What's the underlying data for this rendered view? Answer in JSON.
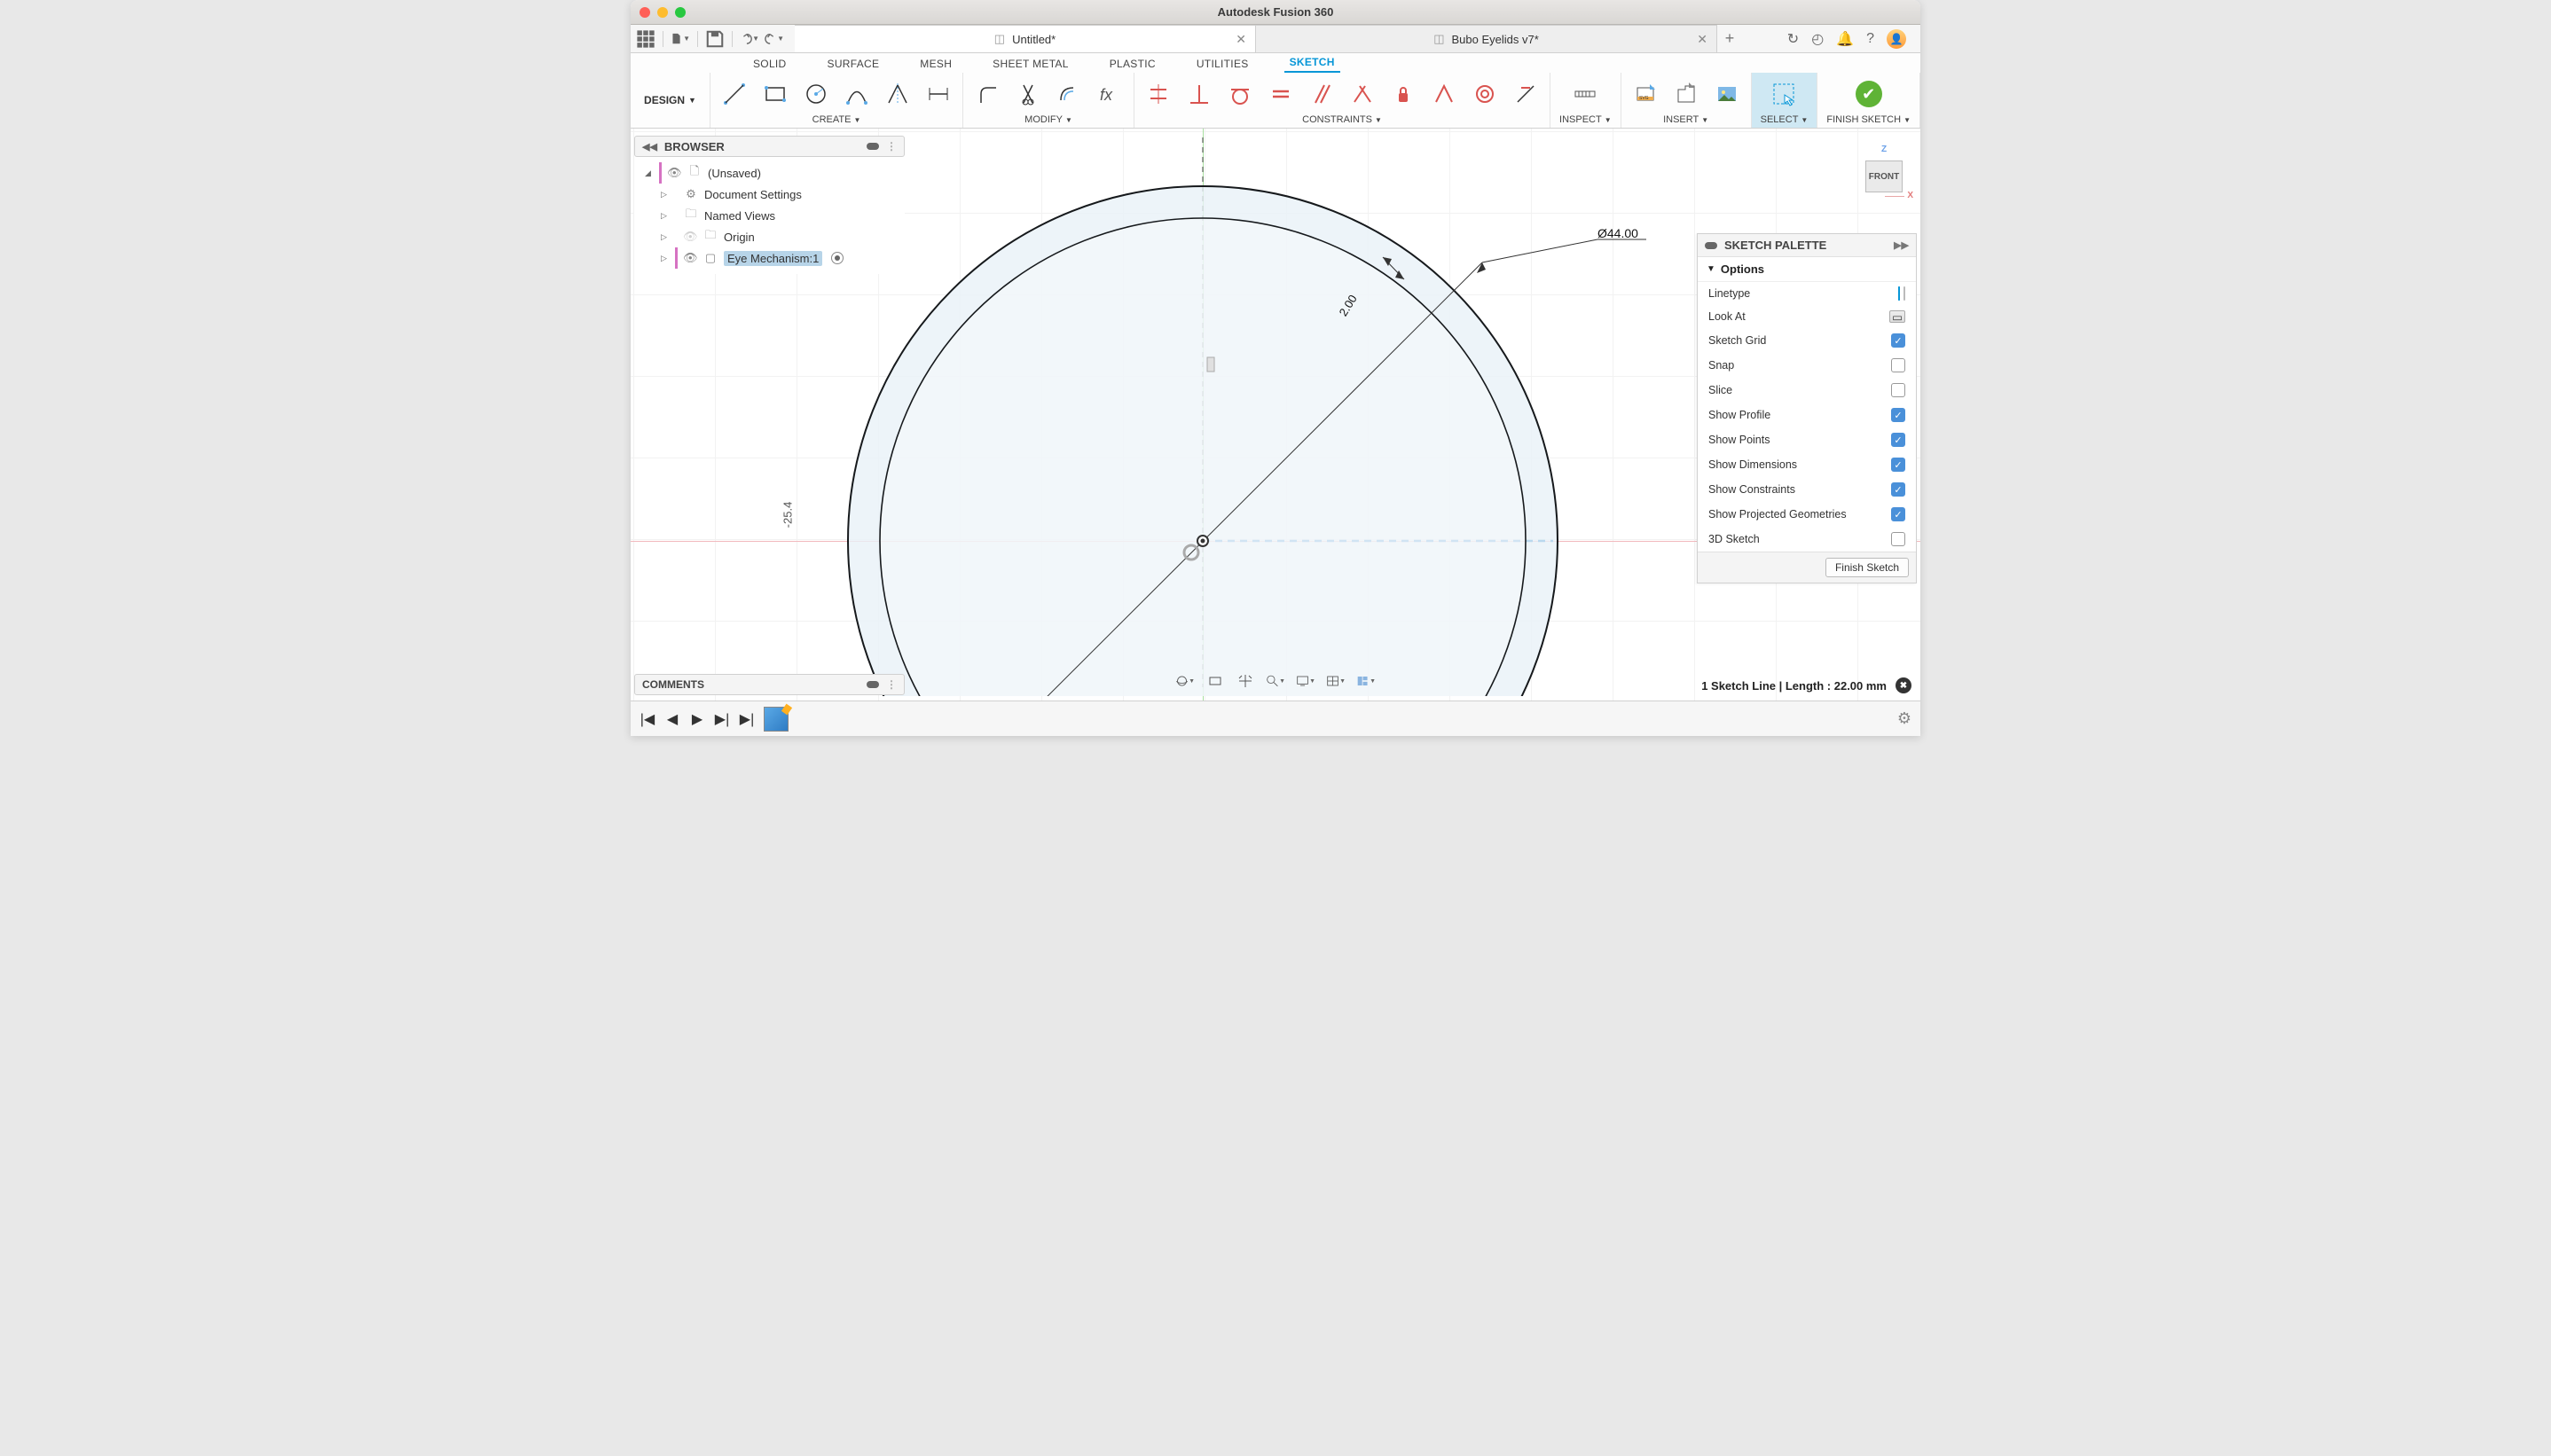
{
  "app_title": "Autodesk Fusion 360",
  "tabs": [
    {
      "label": "Untitled*",
      "active": true
    },
    {
      "label": "Bubo Eyelids v7*",
      "active": false
    }
  ],
  "workspace": "DESIGN",
  "ribbon_tabs": [
    "SOLID",
    "SURFACE",
    "MESH",
    "SHEET METAL",
    "PLASTIC",
    "UTILITIES",
    "SKETCH"
  ],
  "ribbon_active": "SKETCH",
  "ribbon_groups": {
    "create": "CREATE",
    "modify": "MODIFY",
    "constraints": "CONSTRAINTS",
    "inspect": "INSPECT",
    "insert": "INSERT",
    "select": "SELECT",
    "finish": "FINISH SKETCH"
  },
  "browser": {
    "title": "BROWSER",
    "root": "(Unsaved)",
    "items": [
      {
        "label": "Document Settings"
      },
      {
        "label": "Named Views"
      },
      {
        "label": "Origin"
      },
      {
        "label": "Eye Mechanism:1",
        "selected": true
      }
    ]
  },
  "viewcube": {
    "face": "FRONT",
    "z": "Z",
    "x": "X"
  },
  "palette": {
    "title": "SKETCH PALETTE",
    "section": "Options",
    "rows": {
      "linetype": "Linetype",
      "lookat": "Look At",
      "grid": "Sketch Grid",
      "snap": "Snap",
      "slice": "Slice",
      "profile": "Show Profile",
      "points": "Show Points",
      "dims": "Show Dimensions",
      "constraints": "Show Constraints",
      "projected": "Show Projected Geometries",
      "sketch3d": "3D Sketch"
    },
    "checks": {
      "grid": true,
      "snap": false,
      "slice": false,
      "profile": true,
      "points": true,
      "dims": true,
      "constraints": true,
      "projected": true,
      "sketch3d": false
    },
    "finish_button": "Finish Sketch"
  },
  "dimensions": {
    "diameter": "Ø44.00",
    "offset": "2.00",
    "axis": "-25.4"
  },
  "comments": "COMMENTS",
  "status": "1 Sketch Line  |  Length : 22.00 mm"
}
